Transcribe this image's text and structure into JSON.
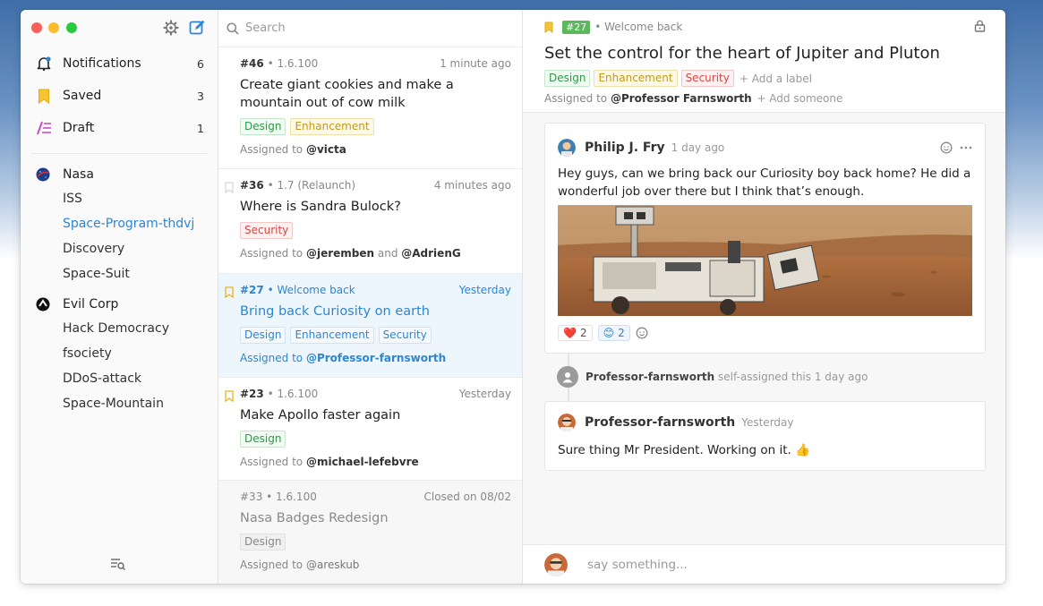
{
  "sidebar": {
    "items": [
      {
        "label": "Notifications",
        "count": "6",
        "icon": "bell-icon"
      },
      {
        "label": "Saved",
        "count": "3",
        "icon": "bookmark-icon"
      },
      {
        "label": "Draft",
        "count": "1",
        "icon": "draft-icon"
      }
    ],
    "groups": [
      {
        "name": "Nasa",
        "items": [
          "ISS",
          "Space-Program-thdvj",
          "Discovery",
          "Space-Suit"
        ]
      },
      {
        "name": "Evil Corp",
        "items": [
          "Hack Democracy",
          "fsociety",
          "DDoS-attack",
          "Space-Mountain"
        ]
      }
    ]
  },
  "search": {
    "placeholder": "Search"
  },
  "issues": [
    {
      "num": "#46",
      "version": " • 1.6.100",
      "time": "1 minute ago",
      "title": "Create giant cookies and make a mountain out of cow milk",
      "labels": [
        "Design",
        "Enhancement"
      ],
      "assigned_prefix": "Assigned to ",
      "assignee": "@victa"
    },
    {
      "num": "#36",
      "version": " • 1.7 (Relaunch)",
      "time": "4 minutes ago",
      "title": "Where is Sandra Bulock?",
      "labels": [
        "Security"
      ],
      "assigned_prefix": "Assigned to ",
      "assignee": "@jeremben",
      "and": " and ",
      "assignee2": "@AdrienG"
    },
    {
      "num": "#27",
      "version": " • Welcome back",
      "time": "Yesterday",
      "title": "Bring back Curiosity on earth",
      "labels": [
        "Design",
        "Enhancement",
        "Security"
      ],
      "assigned_prefix": "Assigned to ",
      "assignee": "@Professor-farnsworth"
    },
    {
      "num": "#23",
      "version": " • 1.6.100",
      "time": "Yesterday",
      "title": "Make Apollo faster again",
      "labels": [
        "Design"
      ],
      "assigned_prefix": "Assigned to ",
      "assignee": "@michael-lefebvre"
    },
    {
      "num": "#33",
      "version": " • 1.6.100",
      "time": "Closed on 08/02",
      "title": "Nasa Badges Redesign",
      "labels": [
        "Design"
      ],
      "assigned_prefix": "Assigned to ",
      "assignee": "@areskub"
    }
  ],
  "detail": {
    "num": "#27",
    "milestone": "• Welcome back",
    "title": "Set the control for the heart of Jupiter and Pluton",
    "labels": [
      "Design",
      "Enhancement",
      "Security"
    ],
    "add_label": "+ Add a label",
    "assigned_prefix": "Assigned to ",
    "assignee": "@Professor Farnsworth",
    "add_someone": " + Add someone",
    "comment1": {
      "author": "Philip J. Fry",
      "time": "1 day ago",
      "body": "Hey guys, can we bring back our Curiosity boy back home? He did a wonderful job over there but I think that’s enough.",
      "reactions": [
        {
          "emoji": "❤️",
          "count": "2"
        },
        {
          "emoji": "😊",
          "count": "2"
        }
      ]
    },
    "event": {
      "actor": "Professor-farnsworth",
      "text": " self-assigned this 1 day ago"
    },
    "comment2": {
      "author": "Professor-farnsworth",
      "time": "Yesterday",
      "body": "Sure thing Mr President. Working on it. 👍"
    },
    "reply_placeholder": "say something..."
  },
  "colors": {
    "accent": "#2c86d4",
    "design": "#2d9b48",
    "enhancement": "#c49a14",
    "security": "#d94444",
    "milestone_badge": "#5cb85c"
  }
}
